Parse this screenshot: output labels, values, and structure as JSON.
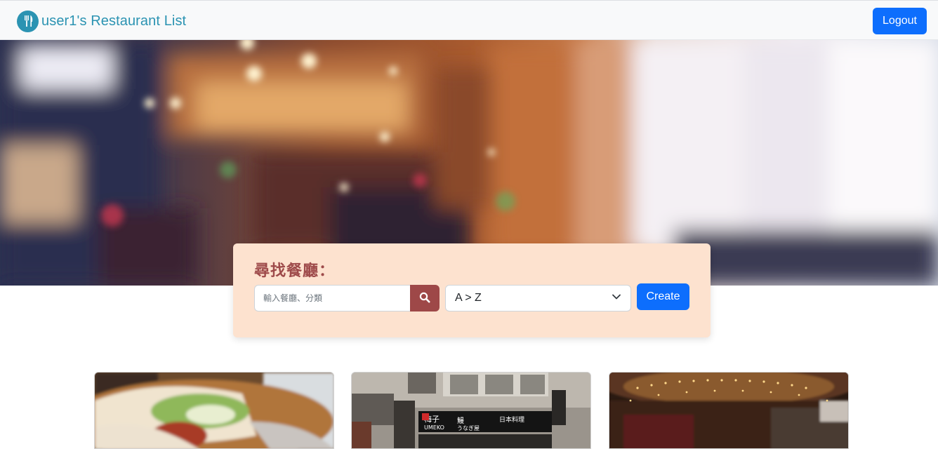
{
  "navbar": {
    "brand_text": "user1's Restaurant List",
    "brand_icon": "utensils-icon",
    "logout_label": "Logout"
  },
  "search": {
    "title": "尋找餐廳：",
    "placeholder": "輸入餐廳、分類",
    "search_icon": "search-icon",
    "sort_selected": "A > Z",
    "create_label": "Create"
  },
  "colors": {
    "brand": "#2b93b2",
    "primary_button": "#0d6efd",
    "search_panel_bg": "#fde2cf",
    "search_accent": "#9e4848"
  },
  "restaurants": [
    {
      "image": "food-wrap-photo"
    },
    {
      "image": "umeko-storefront-photo",
      "sign_text": "梅子 UMEKO うなぎ屋 日本料理"
    },
    {
      "image": "restaurant-interior-photo"
    }
  ]
}
